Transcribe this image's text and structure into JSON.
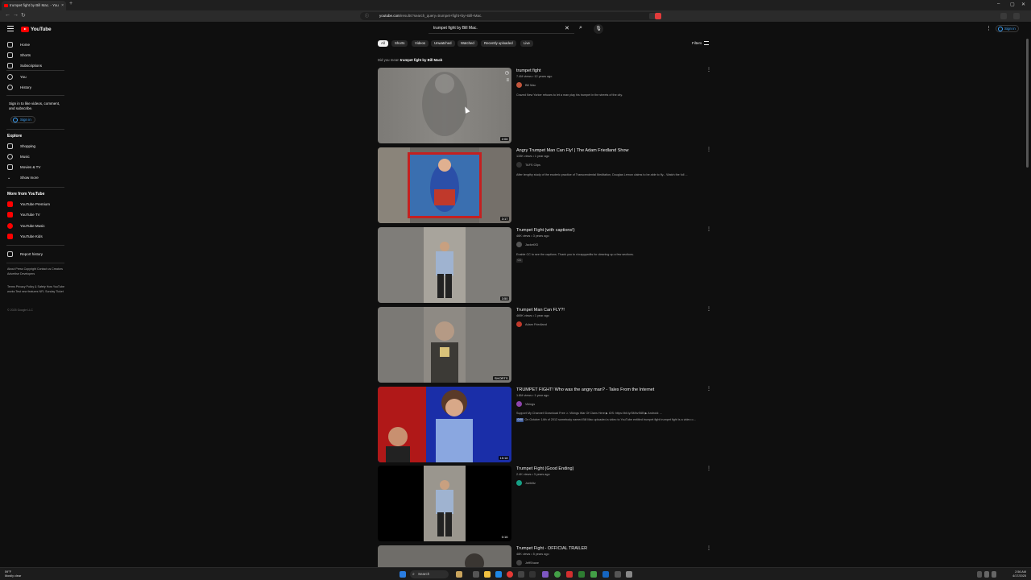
{
  "browser": {
    "tab_title": "trumpet fight by Bill Mac. - You",
    "url_domain": "youtube.com",
    "url_path": "/results?search_query=trumpet+fight+by+Bill+Mac."
  },
  "header": {
    "logo_text": "YouTube",
    "search_value": "trumpet fight by Bill Mac.",
    "sign_in": "Sign in"
  },
  "sidebar": {
    "main": [
      {
        "label": "Home",
        "icon": "home-icon"
      },
      {
        "label": "Shorts",
        "icon": "shorts-icon"
      },
      {
        "label": "Subscriptions",
        "icon": "subscriptions-icon"
      },
      {
        "label": "You",
        "icon": "you-icon"
      },
      {
        "label": "History",
        "icon": "history-icon"
      }
    ],
    "signin_prompt": "Sign in to like videos, comment, and subscribe.",
    "signin_button": "Sign in",
    "explore_heading": "Explore",
    "explore": [
      {
        "label": "Shopping"
      },
      {
        "label": "Music"
      },
      {
        "label": "Movies & TV"
      },
      {
        "label": "Show more"
      }
    ],
    "more_heading": "More from YouTube",
    "more": [
      {
        "label": "YouTube Premium"
      },
      {
        "label": "YouTube TV"
      },
      {
        "label": "YouTube Music"
      },
      {
        "label": "YouTube Kids"
      }
    ],
    "report": "Report history",
    "footer1": "About  Press  Copyright  Contact us  Creators  Advertise  Developers",
    "footer2": "Terms  Privacy  Policy & Safety  How YouTube works  Test new features  NFL Sunday Ticket",
    "footer3": "© 2025 Google LLC"
  },
  "chips": [
    "All",
    "Shorts",
    "Videos",
    "Unwatched",
    "Watched",
    "Recently uploaded",
    "Live"
  ],
  "filters": "Filters",
  "did_you_mean": {
    "prefix": "Did you mean",
    "query": "trumpet fight by Bill Mack"
  },
  "results": [
    {
      "title": "trumpet fight",
      "meta": "7.4M views • 12 years ago",
      "channel": "Bill Mac",
      "desc": "Crazed New Yorker refuses to let a man play his trumpet in the streets of the city.",
      "duration": "2:06"
    },
    {
      "title": "Angry Trumpet Man Can Fly! | The Adam Friedland Show",
      "meta": "133K views • 1 year ago",
      "channel": "TAFS Clips",
      "desc": "After lengthy study of the esoteric practice of Transcendental Meditation, Douglas Lemon claims to be able to fly... Watch the full ...",
      "duration": "3:17"
    },
    {
      "title": "Trumpet Fight (with captions!)",
      "meta": "46K views • 3 years ago",
      "channel": "JacketXD",
      "desc": "Enable CC to see the captions. Thank you to r/crappyedits for cleaning up a few sections.",
      "badge": "CC",
      "duration": "3:50"
    },
    {
      "title": "Trumpet Man Can FLY?!",
      "meta": "469K views • 1 year ago",
      "channel": "Adam Friedland",
      "desc": "",
      "duration": "SHORTS"
    },
    {
      "title": "TRUMPET FIGHT! Who was the angry man? - Tales From the Internet",
      "meta": "1.8M views • 1 year ago",
      "channel": "Vikings",
      "desc": "Support My Channel! Download Free ⚔ Vikings War Of Clans Here ▶ iOS: https://bit.ly/3MhvS6B ▶ Android: ...",
      "desc2": "On October 14th of 2013 somebody named Bill Mac uploaded a video to YouTube entitled trumpet fight trumpet fight is a video o...",
      "badge": "0:00",
      "duration": "15:18"
    },
    {
      "title": "Trumpet Fight (Good Ending)",
      "meta": "2.4K views • 3 years ago",
      "channel": "Joeblitz",
      "desc": "",
      "duration": "0:16"
    },
    {
      "title": "Trumpet Fight - OFFICIAL TRAILER",
      "meta": "48K views • 5 years ago",
      "channel": "JeffShane",
      "desc": "",
      "duration": ""
    }
  ],
  "taskbar": {
    "search": "Search",
    "weather_temp": "59°F",
    "weather_desc": "Mostly clear",
    "time": "2:56 AM",
    "date": "4/17/2025"
  },
  "colors": {
    "brand": "#ff0000",
    "link": "#3ea6ff",
    "bg": "#0f0f0f"
  }
}
